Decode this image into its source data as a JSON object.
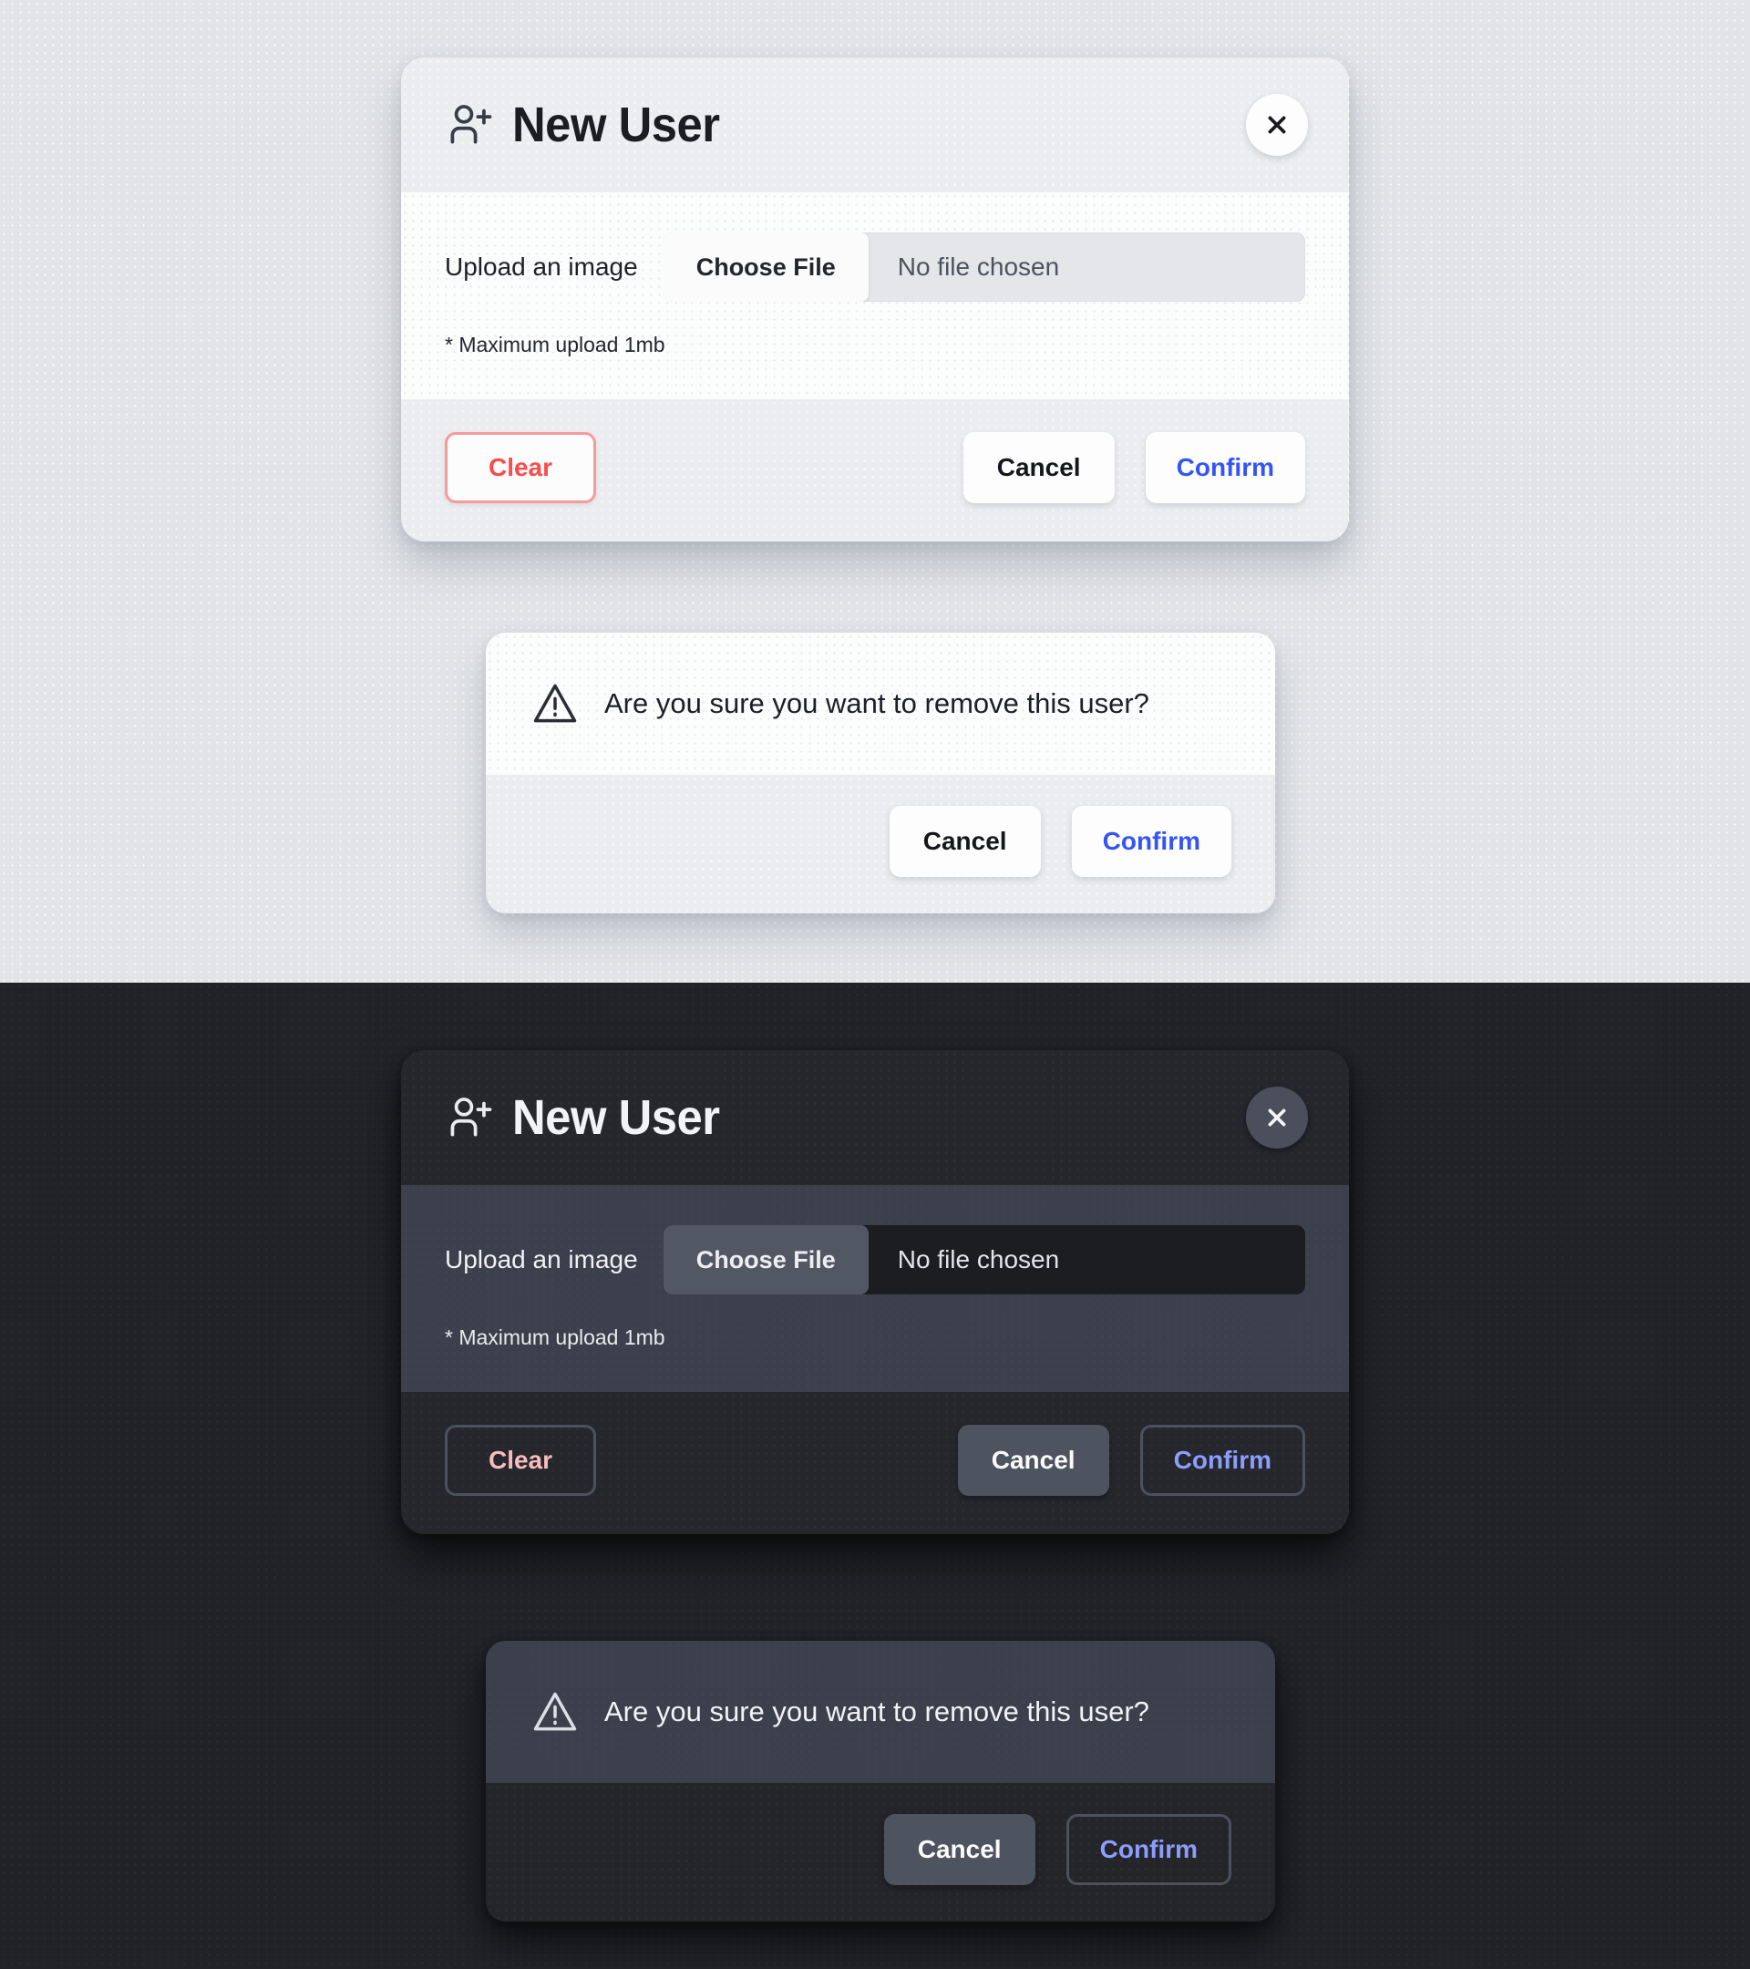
{
  "themes": {
    "light": {
      "name": "light",
      "background_color": "#E2E4E8"
    },
    "dark": {
      "name": "dark",
      "background_color": "#212328"
    }
  },
  "new_user_modal": {
    "title": "New User",
    "title_icon": "user-plus-icon",
    "close_icon": "close-icon",
    "upload": {
      "label": "Upload an image",
      "choose_file_label": "Choose File",
      "file_name_value": "No file chosen",
      "helper_text": "* Maximum upload 1mb"
    },
    "actions": {
      "clear_label": "Clear",
      "cancel_label": "Cancel",
      "confirm_label": "Confirm"
    }
  },
  "remove_user_dialog": {
    "warning_icon": "warning-triangle-icon",
    "message": "Are you sure you want to remove this user?",
    "actions": {
      "cancel_label": "Cancel",
      "confirm_label": "Confirm"
    }
  },
  "colors": {
    "confirm_light": "#3455F5",
    "confirm_dark": "#8C9DFC",
    "clear_light_text": "#FB4B4B",
    "clear_light_border": "#F79A9A",
    "clear_dark_text": "#F8BCBC"
  }
}
